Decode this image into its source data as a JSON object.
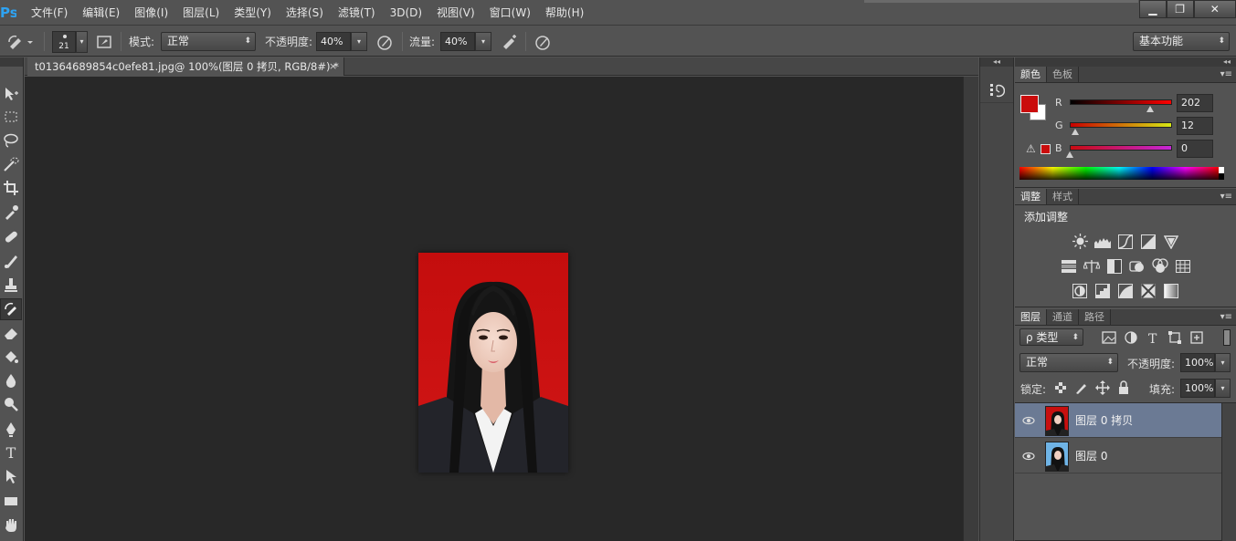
{
  "app": {
    "logo": "Ps"
  },
  "menu": [
    "文件(F)",
    "编辑(E)",
    "图像(I)",
    "图层(L)",
    "类型(Y)",
    "选择(S)",
    "滤镜(T)",
    "3D(D)",
    "视图(V)",
    "窗口(W)",
    "帮助(H)"
  ],
  "window_controls": {
    "minimize": "▁",
    "restore": "❐",
    "close": "✕"
  },
  "options": {
    "brush_size": "21",
    "mode_label": "模式:",
    "mode_value": "正常",
    "opacity_label": "不透明度:",
    "opacity_value": "40%",
    "flow_label": "流量:",
    "flow_value": "40%",
    "workspace": "基本功能"
  },
  "document": {
    "tab_title": "t01364689854c0efe81.jpg@ 100%(图层 0 拷贝, RGB/8#) *",
    "close": "×"
  },
  "dock": {
    "collapse_glyph": "◂◂"
  },
  "color_panel": {
    "tabs": [
      "颜色",
      "色板"
    ],
    "foreground": "#ca0c0c",
    "r_label": "R",
    "r_value": "202",
    "r_fraction": 0.79,
    "g_label": "G",
    "g_value": "12",
    "g_fraction": 0.05,
    "b_label": "B",
    "b_value": "0",
    "b_fraction": 0.0
  },
  "adjustments_panel": {
    "tabs": [
      "调整",
      "样式"
    ],
    "title": "添加调整",
    "icons_row1": [
      "brightness-icon",
      "levels-icon",
      "curves-icon",
      "exposure-icon",
      "vibrance-icon"
    ],
    "icons_row2": [
      "hue-icon",
      "color-balance-icon",
      "black-white-icon",
      "photo-filter-icon",
      "channel-mixer-icon",
      "color-lookup-icon"
    ],
    "icons_row3": [
      "invert-icon",
      "posterize-icon",
      "threshold-icon",
      "selective-color-icon",
      "gradient-map-icon"
    ]
  },
  "layers_panel": {
    "tabs": [
      "图层",
      "通道",
      "路径"
    ],
    "filter_kind": "ρ 类型",
    "blend_mode": "正常",
    "opacity_label": "不透明度:",
    "opacity_value": "100%",
    "lock_label": "锁定:",
    "fill_label": "填充:",
    "fill_value": "100%",
    "layers": [
      {
        "name": "图层 0 拷贝",
        "selected": true,
        "bg": "#c80f0f"
      },
      {
        "name": "图层 0",
        "selected": false,
        "bg": "#6fb4e6"
      }
    ]
  },
  "menu_glyph": "▾≡"
}
